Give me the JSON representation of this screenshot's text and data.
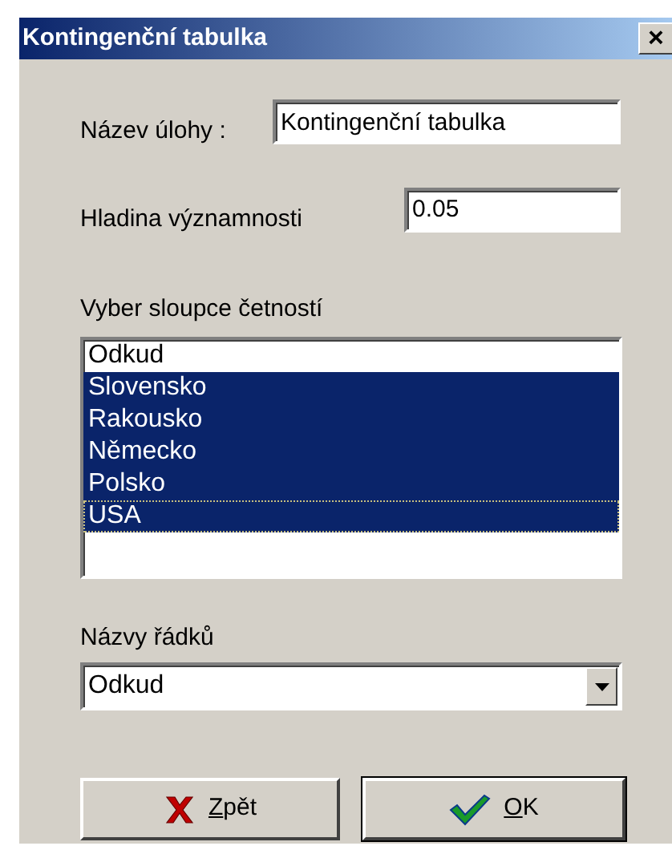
{
  "window": {
    "title": "Kontingenční tabulka",
    "close": "×"
  },
  "fields": [
    {
      "label": "Název úlohy :",
      "value": "Kontingenční tabulka"
    },
    {
      "label": "Hladina významnosti",
      "value": "0.05"
    }
  ],
  "list": {
    "label": "Vyber sloupce četností",
    "items": [
      {
        "text": "Odkud",
        "selected": false,
        "focused": false
      },
      {
        "text": "Slovensko",
        "selected": true,
        "focused": false
      },
      {
        "text": "Rakousko",
        "selected": true,
        "focused": false
      },
      {
        "text": "Německo",
        "selected": true,
        "focused": false
      },
      {
        "text": "Polsko",
        "selected": true,
        "focused": false
      },
      {
        "text": "USA",
        "selected": true,
        "focused": true
      }
    ]
  },
  "combo": {
    "label": "Názvy řádků",
    "value": "Odkud"
  },
  "buttons": [
    {
      "kind": "cancel",
      "label": "Zpět",
      "default": false
    },
    {
      "kind": "ok",
      "label": "OK",
      "default": true
    }
  ]
}
